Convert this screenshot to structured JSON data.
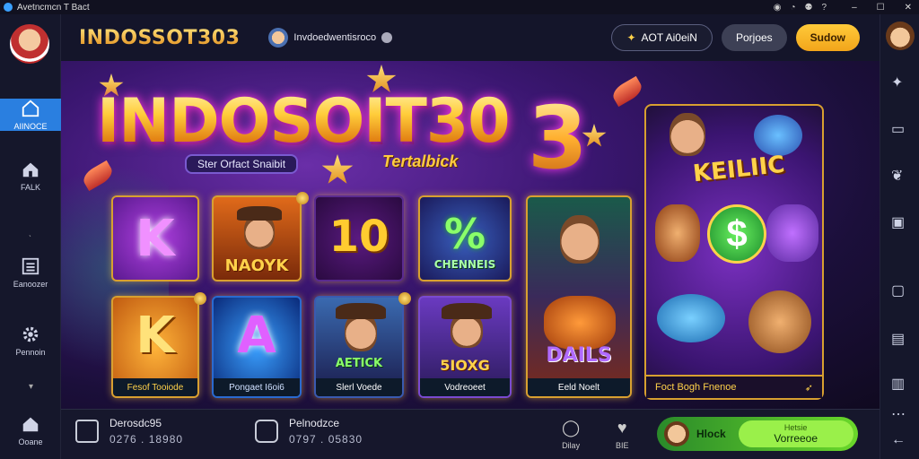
{
  "window": {
    "title": "Avetncmcn T Bact",
    "sys_icons": [
      "record-icon",
      "bell-icon",
      "help-icon"
    ],
    "sys_glyphs": [
      "◉",
      "◔",
      "⚉",
      "?"
    ]
  },
  "sidebar": {
    "items": [
      {
        "label": "AIINOCE",
        "icon": "home-icon",
        "active": true
      },
      {
        "label": "FALK",
        "icon": "house-icon"
      },
      {
        "label": "Eanoozer",
        "icon": "list-icon"
      },
      {
        "label": "Pennoin",
        "icon": "gear-icon"
      },
      {
        "label": "Ooane",
        "icon": "home-icon"
      }
    ]
  },
  "header": {
    "brand": "INDOSSOT303",
    "username": "Invdoedwentisroco",
    "act_button": "AOT Ai0eiN",
    "act_icon": "✦",
    "prog_button": "Porjoes",
    "signup_button": "Sudow"
  },
  "banner": {
    "title": "INDOSOIT30",
    "title_suffix": "3",
    "subtitle": "Ster Orfact Snaibit",
    "tag": "Tertalbick",
    "tiles": [
      {
        "big": "K",
        "caption": ""
      },
      {
        "big": "NAOYK",
        "caption": ""
      },
      {
        "big": "10",
        "caption": ""
      },
      {
        "big": "CHENNEIS",
        "caption": ""
      },
      {
        "big": "K",
        "caption": "Fesof Tooiode"
      },
      {
        "big": "A",
        "caption": "Pongaet I6oi6"
      },
      {
        "big": "AETICK",
        "caption": "Slerl Voede"
      },
      {
        "big": "5IOXG",
        "caption": "Vodreoeet"
      },
      {
        "big": "DAILS",
        "caption": "Eeld Noelt"
      }
    ],
    "feature": {
      "title": "KEILIIC",
      "symbol": "$",
      "caption": "Foct Bogh Fnenoe",
      "arrow": "➶"
    }
  },
  "bottombar": {
    "stat1": {
      "label": "Derosdc95",
      "value": "0276 . 18980"
    },
    "stat2": {
      "label": "Pelnodzce",
      "value": "0797 . 05830"
    },
    "small1": {
      "label": "Dilay",
      "glyph": "◯"
    },
    "small2": {
      "label": "BIE",
      "glyph": "♥"
    },
    "play": {
      "label": "Hlock",
      "top": "Hetsie",
      "bottom": "Vorreeoe"
    }
  },
  "rail": {
    "icons": [
      "rocket-icon",
      "card-icon",
      "bird-icon",
      "image-icon",
      "window-icon",
      "doc-icon",
      "download-icon",
      "more-icon",
      "back-icon"
    ],
    "glyphs": [
      "✦",
      "▭",
      "❦",
      "▣",
      "▢",
      "▤",
      "▥",
      "⋯",
      "←"
    ]
  }
}
